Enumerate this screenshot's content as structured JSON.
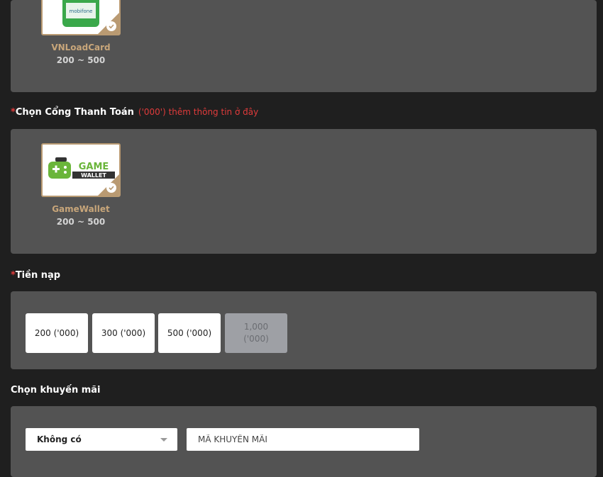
{
  "cards_section": {
    "items": [
      {
        "name": "VNLoadCard",
        "range": "200 ~ 500",
        "logo_sub": "mobifone"
      }
    ]
  },
  "gateway_section": {
    "required_mark": "*",
    "label": "Chọn Cổng Thanh Toán",
    "hint": "('000') thêm thông tin ở đây",
    "items": [
      {
        "name": "GameWallet",
        "range": "200 ~ 500",
        "logo_line1": "GAME",
        "logo_line2": "WALLET"
      }
    ]
  },
  "amount_section": {
    "required_mark": "*",
    "label": "Tiền nạp",
    "options": [
      {
        "label": "200 ('000)"
      },
      {
        "label": "300 ('000)"
      },
      {
        "label": "500 ('000)"
      },
      {
        "label_line1": "1,000",
        "label_line2": "('000)"
      }
    ]
  },
  "promo_section": {
    "label": "Chọn khuyến mãi",
    "select_value": "Không có",
    "input_placeholder": "MÃ KHUYẾN MÃI"
  },
  "colors": {
    "background": "#1f1f1f",
    "panel": "#535353",
    "accent_gold": "#c8a67a",
    "required_red": "#e03b3b"
  }
}
